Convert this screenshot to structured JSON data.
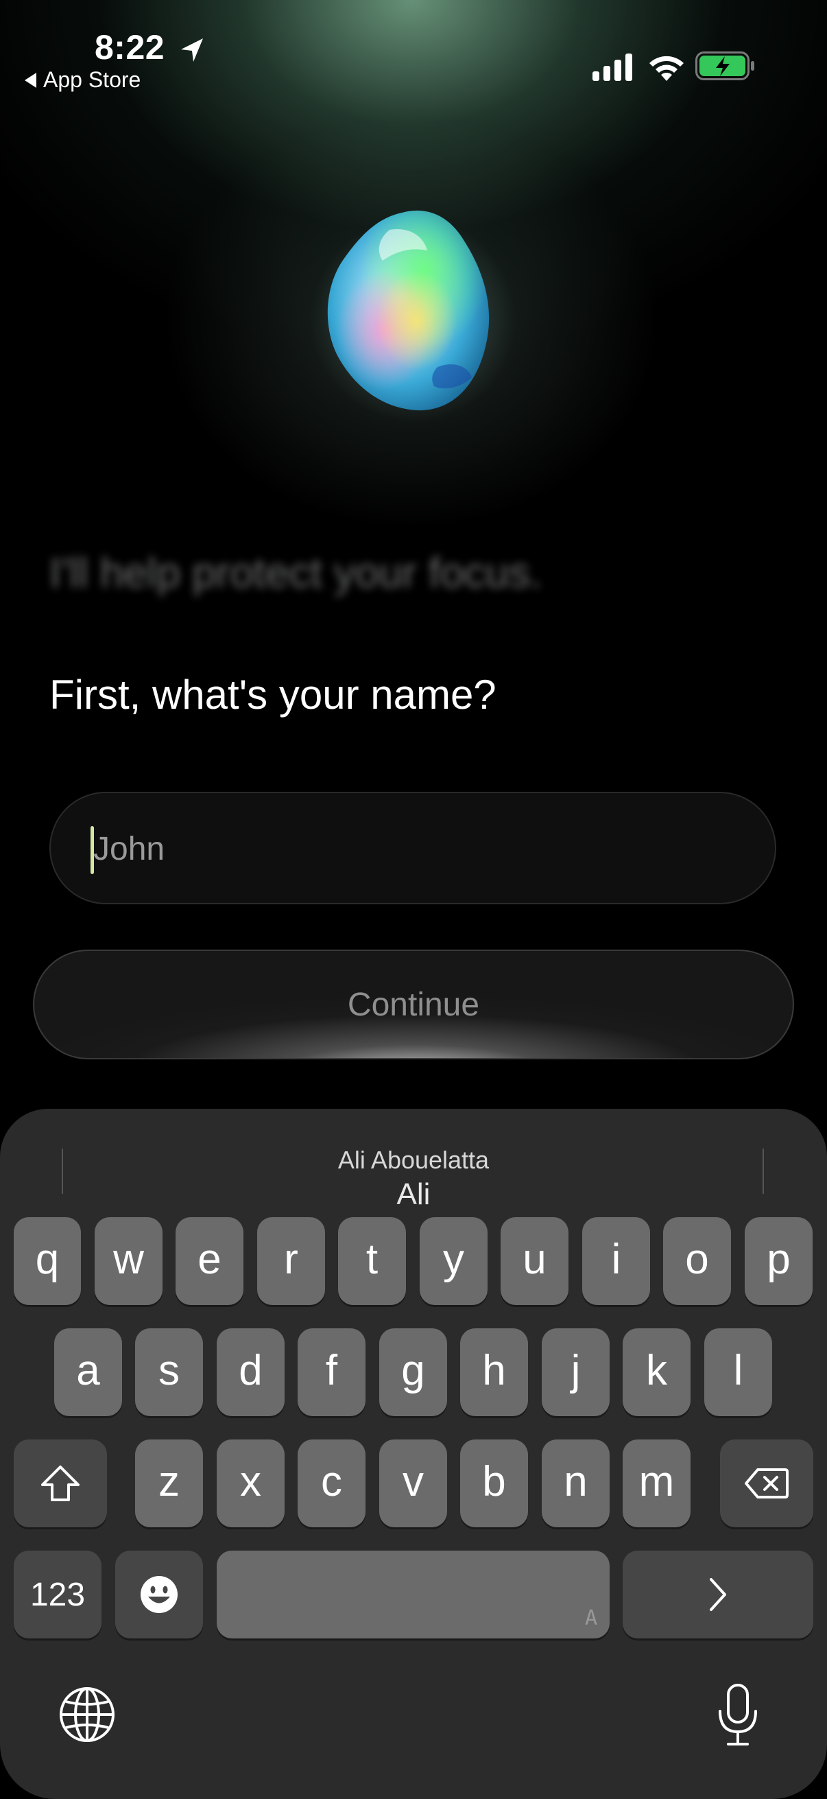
{
  "status_bar": {
    "time": "8:22",
    "back_label": "App Store",
    "battery_color": "#34c759"
  },
  "onboarding": {
    "tagline": "I'll help protect your focus.",
    "question": "First, what's your name?",
    "name_placeholder": "John",
    "name_value": "",
    "continue_label": "Continue"
  },
  "keyboard": {
    "suggestion_top": "Ali Abouelatta",
    "suggestion_main": "Ali",
    "row1": [
      "q",
      "w",
      "e",
      "r",
      "t",
      "y",
      "u",
      "i",
      "o",
      "p"
    ],
    "row2": [
      "a",
      "s",
      "d",
      "f",
      "g",
      "h",
      "j",
      "k",
      "l"
    ],
    "row3": [
      "z",
      "x",
      "c",
      "v",
      "b",
      "n",
      "m"
    ],
    "numbers_label": "123",
    "space_accent": "A",
    "icons": {
      "shift": "shift-icon",
      "delete": "delete-icon",
      "emoji": "emoji-icon",
      "return": "chevron-right-icon",
      "globe": "globe-icon",
      "mic": "microphone-icon"
    }
  }
}
